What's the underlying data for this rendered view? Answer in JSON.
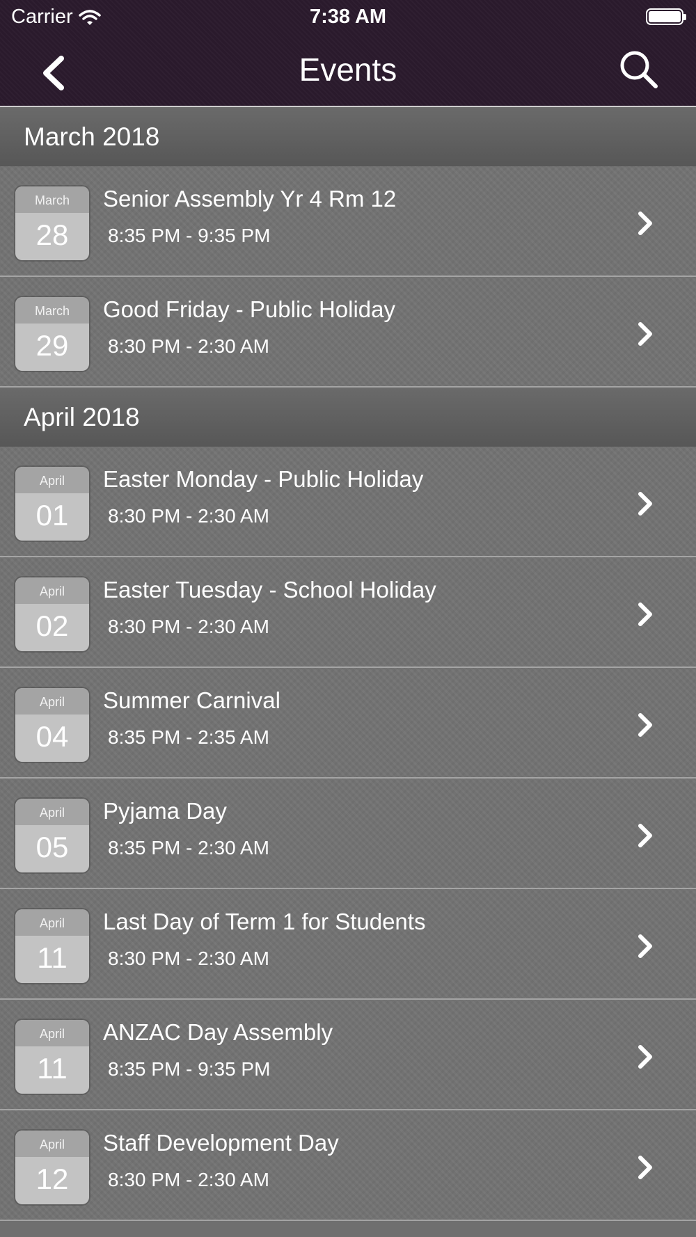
{
  "status_bar": {
    "carrier": "Carrier",
    "time": "7:38 AM"
  },
  "nav": {
    "title": "Events",
    "back_icon": "chevron-left-icon",
    "search_icon": "search-icon"
  },
  "sections": [
    {
      "header": "March 2018",
      "events": [
        {
          "month": "March",
          "day": "28",
          "title": "Senior Assembly Yr 4 Rm 12",
          "time": "8:35 PM - 9:35 PM"
        },
        {
          "month": "March",
          "day": "29",
          "title": "Good Friday - Public Holiday",
          "time": "8:30 PM - 2:30 AM"
        }
      ]
    },
    {
      "header": "April 2018",
      "events": [
        {
          "month": "April",
          "day": "01",
          "title": "Easter Monday - Public Holiday",
          "time": "8:30 PM - 2:30 AM"
        },
        {
          "month": "April",
          "day": "02",
          "title": "Easter Tuesday - School Holiday",
          "time": "8:30 PM - 2:30 AM"
        },
        {
          "month": "April",
          "day": "04",
          "title": "Summer Carnival",
          "time": "8:35 PM - 2:35 AM"
        },
        {
          "month": "April",
          "day": "05",
          "title": "Pyjama Day",
          "time": "8:35 PM - 2:30 AM"
        },
        {
          "month": "April",
          "day": "11",
          "title": "Last Day of Term 1 for Students",
          "time": "8:30 PM - 2:30 AM"
        },
        {
          "month": "April",
          "day": "11",
          "title": "ANZAC Day Assembly",
          "time": "8:35 PM - 9:35 PM"
        },
        {
          "month": "April",
          "day": "12",
          "title": "Staff Development Day",
          "time": "8:30 PM - 2:30 AM"
        }
      ]
    }
  ]
}
